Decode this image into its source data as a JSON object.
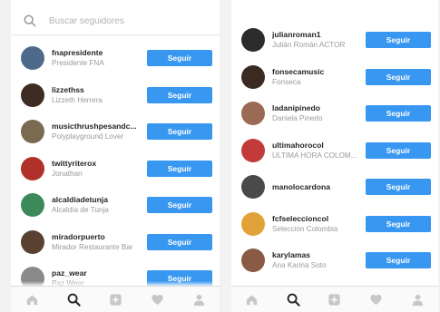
{
  "search": {
    "placeholder": "Buscar seguidores"
  },
  "follow_label": "Seguir",
  "colors": {
    "accent": "#3897f0",
    "text": "#262626",
    "muted": "#9a9a9a"
  },
  "left_list": [
    {
      "username": "fnapresidente",
      "full_name": "Presidente FNA",
      "avatar_color": "#4d6a8a"
    },
    {
      "username": "lizzethss",
      "full_name": "Lizzeth Herrera",
      "avatar_color": "#3d2b24"
    },
    {
      "username": "musicthrushpesandc...",
      "full_name": "Polyplayground Lover",
      "avatar_color": "#7a6a50"
    },
    {
      "username": "twittyriterox",
      "full_name": "Jonathan",
      "avatar_color": "#b0312a"
    },
    {
      "username": "alcaldiadetunja",
      "full_name": "Alcaldía de Tunja",
      "avatar_color": "#3c8a5a"
    },
    {
      "username": "miradorpuerto",
      "full_name": "Mirador Restaurante Bar",
      "avatar_color": "#5a4030"
    },
    {
      "username": "paz_wear",
      "full_name": "Paz Wear",
      "avatar_color": "#8a8a8a"
    }
  ],
  "right_list": [
    {
      "username": "julianroman1",
      "full_name": "Julián Román ACTOR",
      "avatar_color": "#2b2b2b"
    },
    {
      "username": "fonsecamusic",
      "full_name": "Fonseca",
      "avatar_color": "#3a2a22"
    },
    {
      "username": "ladanipinedo",
      "full_name": "Daniela Pinedo",
      "avatar_color": "#9a6a55"
    },
    {
      "username": "ultimahorocol",
      "full_name": "ULTIMA HORA COLOM...",
      "avatar_color": "#c23a3a"
    },
    {
      "username": "manolocardona",
      "full_name": "",
      "avatar_color": "#4a4a4a"
    },
    {
      "username": "fcfseleccioncol",
      "full_name": "Selección Colombia",
      "avatar_color": "#e2a23a"
    },
    {
      "username": "karylamas",
      "full_name": "Ana Karina Soto",
      "avatar_color": "#8a5a45"
    }
  ],
  "tabs": [
    {
      "name": "home-icon",
      "active": false
    },
    {
      "name": "search-icon",
      "active": true
    },
    {
      "name": "add-icon",
      "active": false
    },
    {
      "name": "heart-icon",
      "active": false
    },
    {
      "name": "profile-icon",
      "active": false
    }
  ]
}
